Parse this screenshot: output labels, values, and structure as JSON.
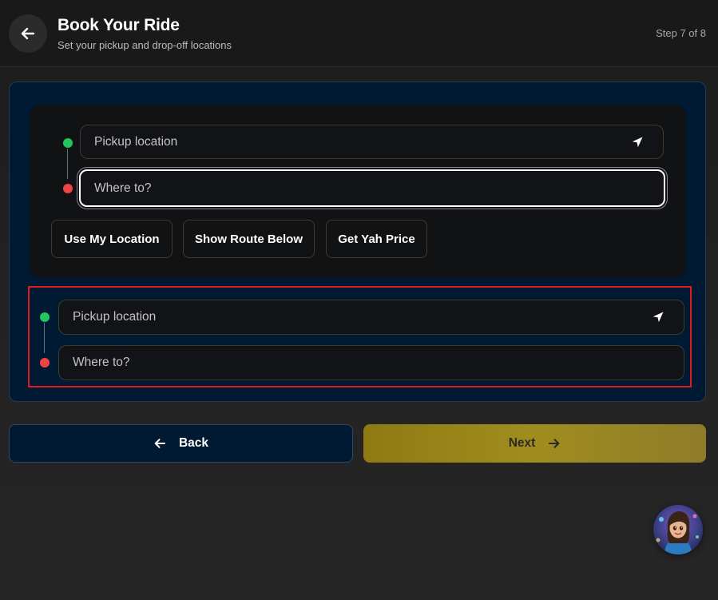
{
  "header": {
    "title": "Book Your Ride",
    "subtitle": "Set your pickup and drop-off locations",
    "step": "Step 7 of 8"
  },
  "primary_form": {
    "pickup_placeholder": "Pickup location",
    "dropoff_placeholder": "Where to?",
    "actions": [
      "Use My Location",
      "Show Route Below",
      "Get Yah Price"
    ]
  },
  "secondary_form": {
    "pickup_placeholder": "Pickup location",
    "dropoff_placeholder": "Where to?"
  },
  "footer": {
    "back_label": "Back",
    "next_label": "Next"
  },
  "colors": {
    "pickup_dot": "#22c55e",
    "dropoff_dot": "#ef4444",
    "panel_bg": "#011a33",
    "next_button": "#a08d1e",
    "highlight_border": "#e01b1b"
  },
  "icons": {
    "header_back": "arrow-left-icon",
    "locate": "navigation-arrow-icon",
    "back": "arrow-left-icon",
    "next": "arrow-right-icon",
    "assistant": "assistant-avatar"
  }
}
